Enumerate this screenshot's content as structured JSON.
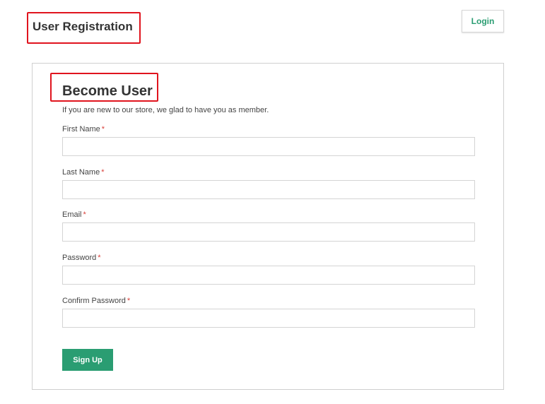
{
  "header": {
    "title": "User Registration",
    "login_label": "Login"
  },
  "form": {
    "title": "Become User",
    "subtitle": "If you are new to our store, we glad to have you as member.",
    "required_marker": "*",
    "fields": [
      {
        "label": "First Name",
        "value": "",
        "placeholder": ""
      },
      {
        "label": "Last Name",
        "value": "",
        "placeholder": ""
      },
      {
        "label": "Email",
        "value": "",
        "placeholder": ""
      },
      {
        "label": "Password",
        "value": "",
        "placeholder": ""
      },
      {
        "label": "Confirm Password",
        "value": "",
        "placeholder": ""
      }
    ],
    "submit_label": "Sign Up"
  },
  "colors": {
    "accent": "#2a9d72",
    "required": "#d9403a",
    "highlight": "#e0141e"
  }
}
